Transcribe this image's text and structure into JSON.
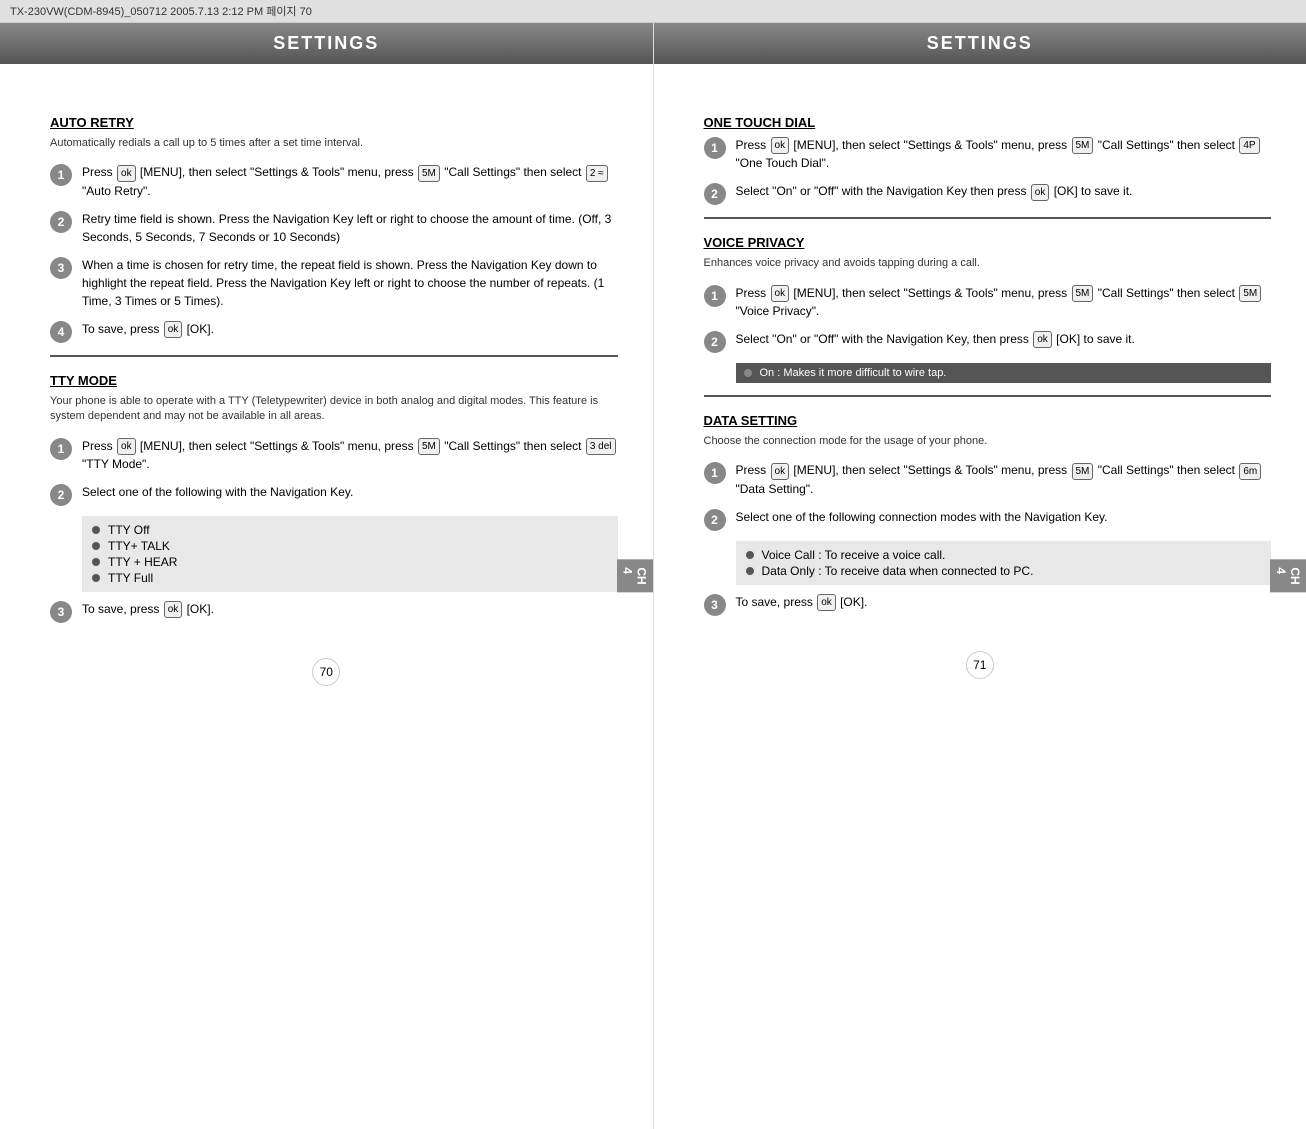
{
  "topBar": {
    "text": "TX-230VW(CDM-8945)_050712  2005.7.13  2:12 PM  페이지 70"
  },
  "leftPanel": {
    "header": "SETTINGS",
    "sideTab": "CH\n4",
    "autoRetry": {
      "title": "AUTO RETRY",
      "desc": "Automatically redials a call up to 5 times after a set time interval.",
      "steps": [
        {
          "num": "1",
          "text": "Press [MENU], then select \"Settings & Tools\" menu, press [5] \"Call Settings\" then select [2] \"Auto Retry\"."
        },
        {
          "num": "2",
          "text": "Retry time field is shown. Press the Navigation Key left or right to choose the amount of time. (Off, 3 Seconds, 5 Seconds, 7 Seconds or 10 Seconds)"
        },
        {
          "num": "3",
          "text": "When a time is chosen for retry time, the repeat field is shown. Press the Navigation Key down to highlight the repeat field. Press the Navigation Key left or right to choose the number of repeats. (1 Time, 3 Times or 5 Times)."
        },
        {
          "num": "4",
          "text": "To save, press [OK] [OK]."
        }
      ]
    },
    "ttyMode": {
      "title": "TTY MODE",
      "desc": "Your phone is able to operate with a TTY (Teletypewriter) device in both analog and digital modes. This feature is system dependent and may not be available in all areas.",
      "steps": [
        {
          "num": "1",
          "text": "Press [MENU], then select \"Settings & Tools\" menu, press [5] \"Call Settings\" then select [3] \"TTY Mode\"."
        },
        {
          "num": "2",
          "text": "Select one of the following with the Navigation Key."
        }
      ],
      "bulletItems": [
        "TTY Off",
        "TTY+ TALK",
        "TTY + HEAR",
        "TTY Full"
      ],
      "step3": {
        "num": "3",
        "text": "To save, press [OK] [OK]."
      }
    },
    "pageNum": "70"
  },
  "rightPanel": {
    "header": "SETTINGS",
    "sideTab": "CH\n4",
    "oneTouchDial": {
      "title": "ONE TOUCH DIAL",
      "steps": [
        {
          "num": "1",
          "text": "Press [MENU], then select \"Settings & Tools\" menu, press [5] \"Call Settings\" then select [4] \"One Touch Dial\"."
        },
        {
          "num": "2",
          "text": "Select \"On\" or \"Off\" with the Navigation Key then press [OK] [OK] to save it."
        }
      ]
    },
    "voicePrivacy": {
      "title": "VOICE PRIVACY",
      "desc": "Enhances voice privacy and avoids tapping during a call.",
      "steps": [
        {
          "num": "1",
          "text": "Press [MENU], then select \"Settings & Tools\" menu, press [5] \"Call Settings\" then select [5] \"Voice Privacy\"."
        },
        {
          "num": "2",
          "text": "Select \"On\" or \"Off\" with the Navigation Key, then press [OK] [OK] to save it."
        }
      ],
      "note": "On : Makes it more difficult to wire tap."
    },
    "dataSetting": {
      "title": "DATA SETTING",
      "desc": "Choose the connection mode for the usage of your phone.",
      "steps": [
        {
          "num": "1",
          "text": "Press [MENU], then select \"Settings & Tools\" menu, press [5] \"Call Settings\" then select [6] \"Data Setting\"."
        },
        {
          "num": "2",
          "text": "Select one of the following connection modes with the Navigation Key."
        }
      ],
      "bulletItems": [
        "Voice Call : To receive a voice call.",
        "Data Only : To receive data when connected to PC."
      ],
      "step3": {
        "num": "3",
        "text": "To save, press [OK] [OK]."
      }
    },
    "pageNum": "71"
  }
}
